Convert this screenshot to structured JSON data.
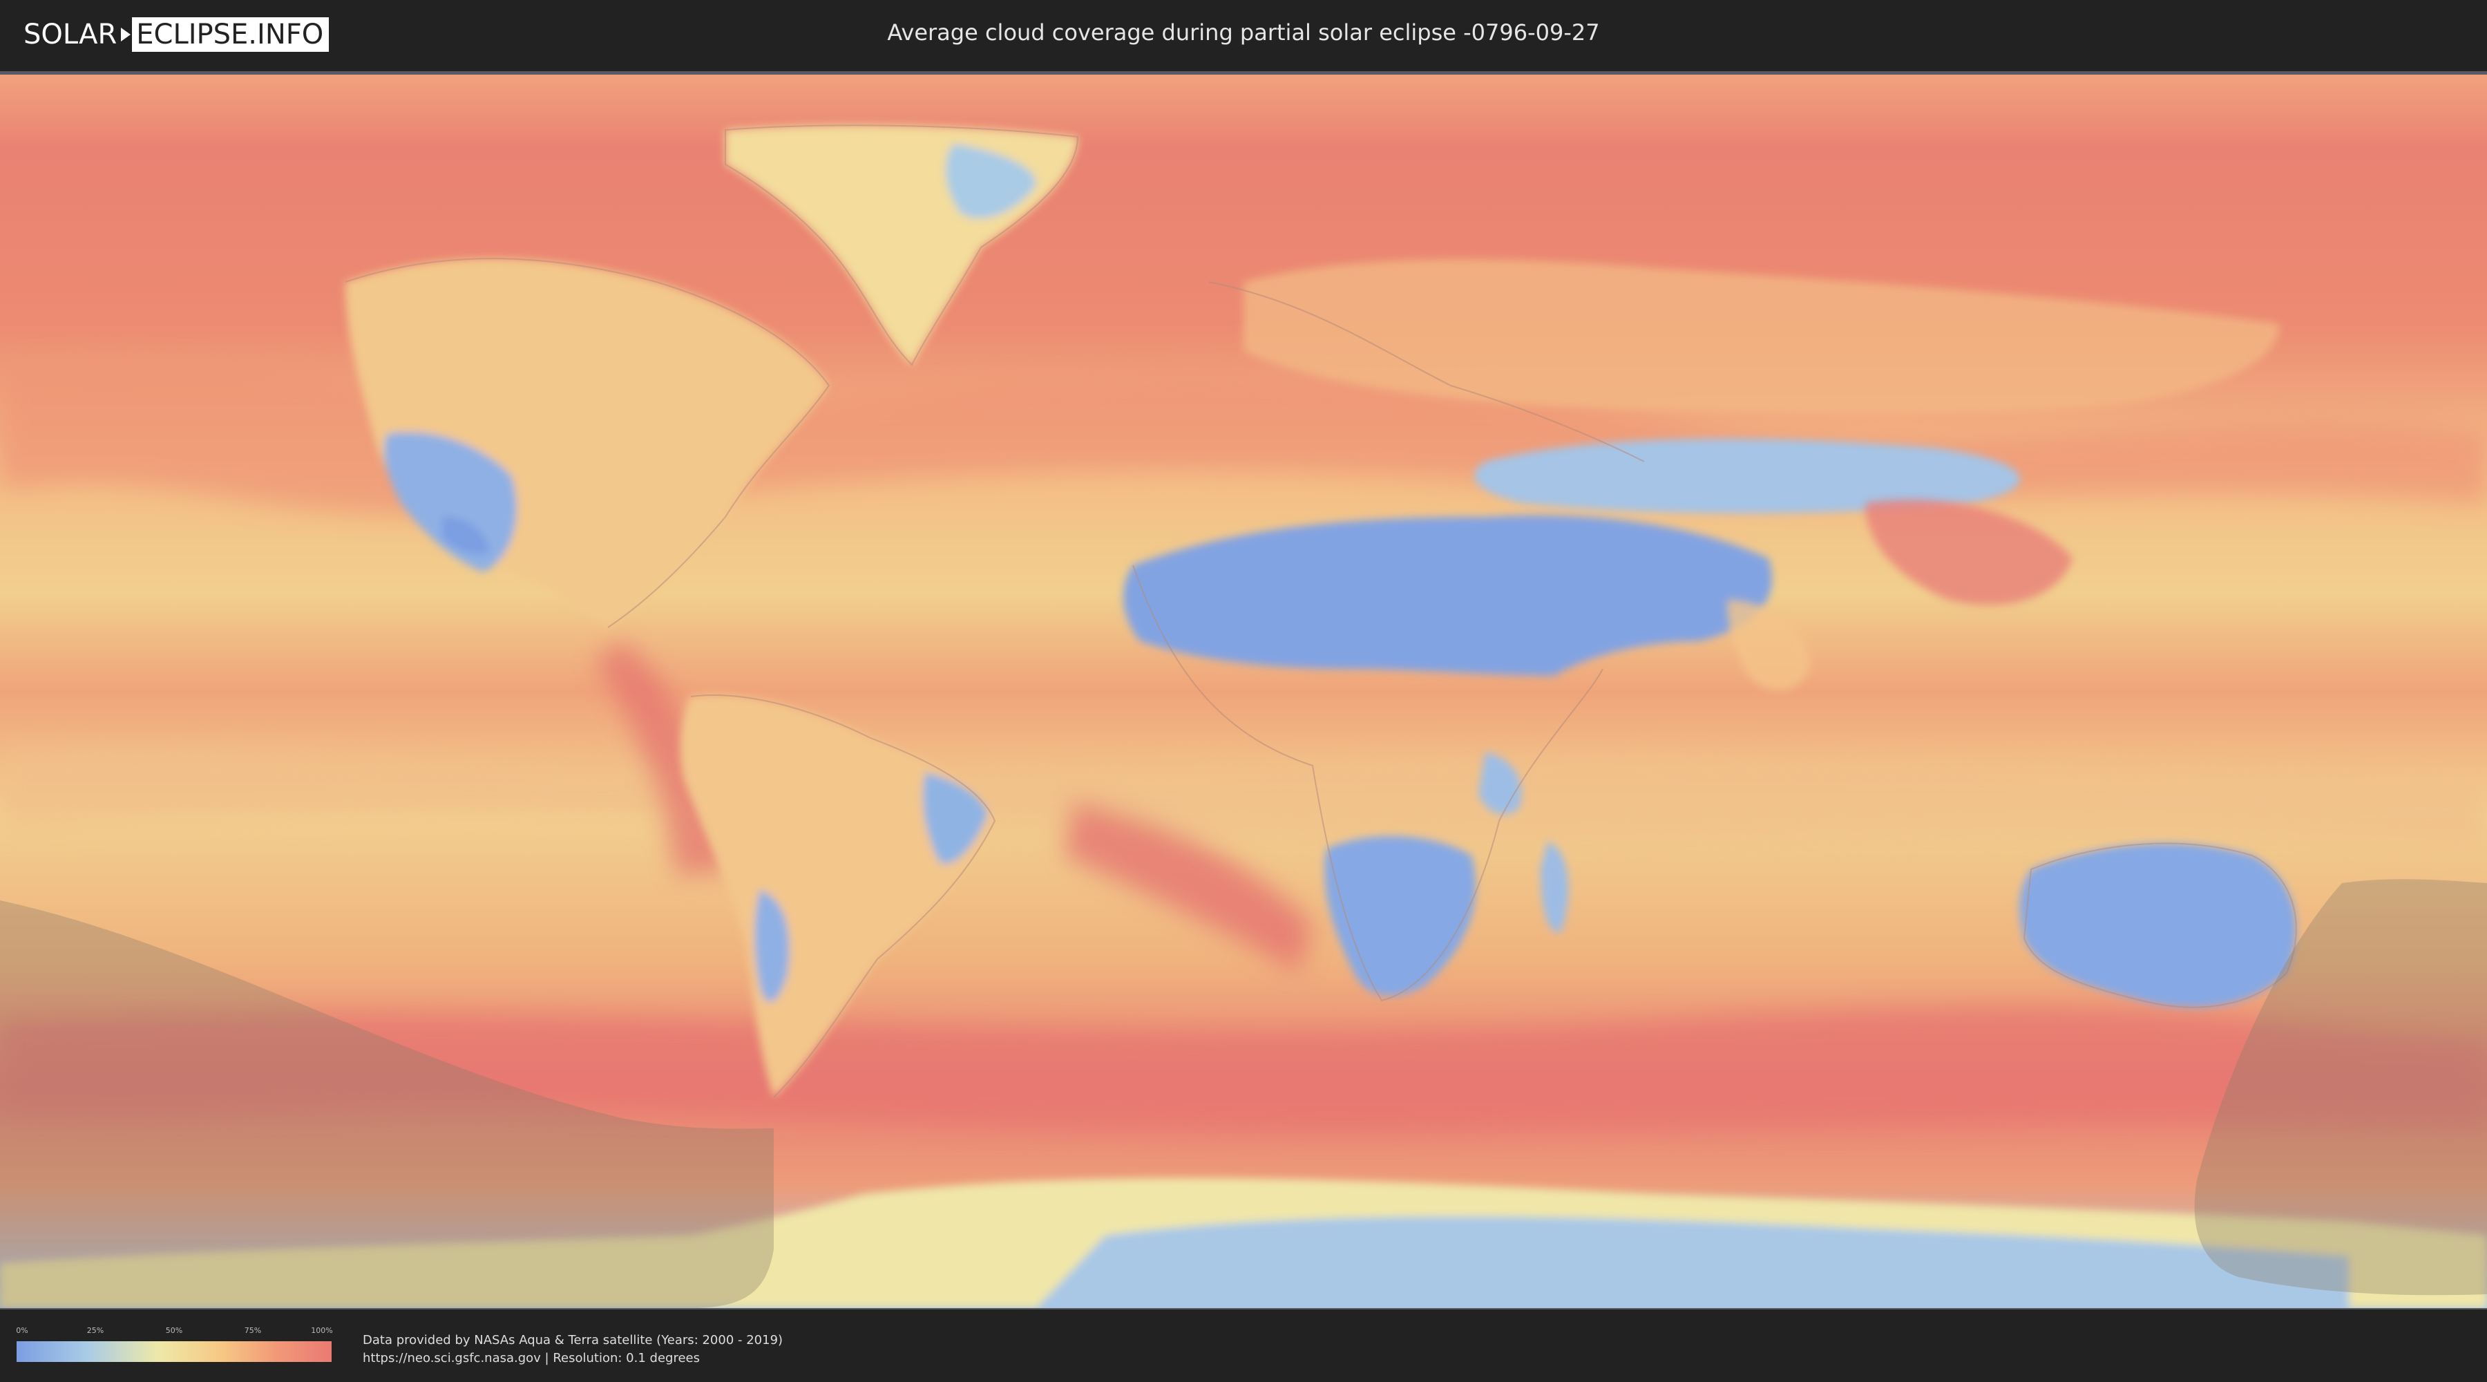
{
  "header": {
    "logo_left": "SOLAR",
    "logo_right": "ECLIPSE.INFO",
    "title": "Average cloud coverage during partial solar eclipse -0796-09-27"
  },
  "map": {
    "description_icon": "world-cloud-map",
    "colors": {
      "clear": "#7c9ee2",
      "low": "#a8cbe7",
      "mid": "#eee8a8",
      "high": "#f6c884",
      "very_high": "#ea7a72",
      "eclipse_overlay": "#8a7a66"
    }
  },
  "legend": {
    "ticks": [
      "0%",
      "25%",
      "50%",
      "75%",
      "100%"
    ]
  },
  "footer": {
    "credit_line1": "Data provided by NASAs Aqua & Terra satellite (Years: 2000 - 2019)",
    "credit_line2": "https://neo.sci.gsfc.nasa.gov | Resolution: 0.1 degrees"
  }
}
